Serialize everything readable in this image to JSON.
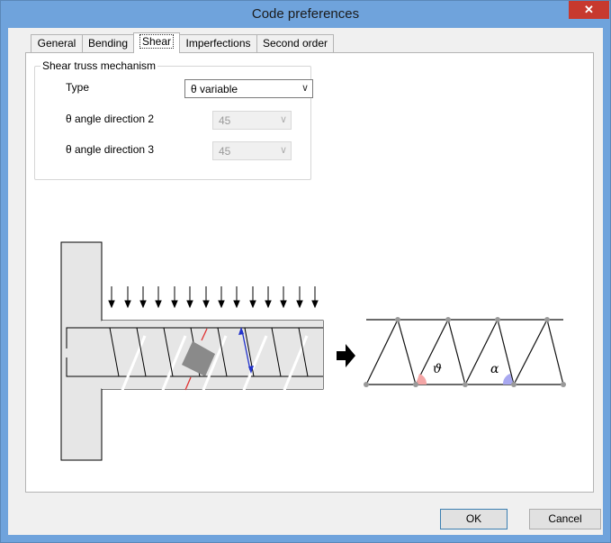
{
  "window": {
    "title": "Code preferences",
    "close_glyph": "✕"
  },
  "tabs": [
    {
      "label": "General",
      "active": false
    },
    {
      "label": "Bending",
      "active": false
    },
    {
      "label": "Shear",
      "active": true
    },
    {
      "label": "Imperfections",
      "active": false
    },
    {
      "label": "Second order",
      "active": false
    }
  ],
  "group": {
    "title": "Shear truss mechanism",
    "rows": [
      {
        "label": "Type",
        "value": "θ variable",
        "enabled": true
      },
      {
        "label": "θ angle direction 2",
        "value": "45",
        "enabled": false
      },
      {
        "label": "θ angle direction 3",
        "value": "45",
        "enabled": false
      }
    ]
  },
  "diagram": {
    "theta_symbol": "ϑ",
    "alpha_symbol": "α",
    "colors": {
      "theta_sector": "#f4a6a6",
      "alpha_sector": "#a8a8f0",
      "strut": "#888888",
      "stirrup_arrow": "#2233cc",
      "compression_arrow": "#e03030"
    }
  },
  "buttons": {
    "ok": "OK",
    "cancel": "Cancel"
  },
  "icons": {
    "close": "close-icon",
    "dropdown": "chevron-down-icon",
    "arrow": "right-arrow-icon"
  }
}
